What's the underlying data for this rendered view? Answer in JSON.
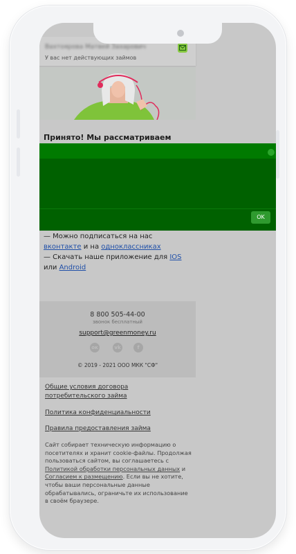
{
  "user": {
    "name": "Вахтоярова Матвей Захарович",
    "status": "У вас нет действующих займов"
  },
  "main": {
    "title": "Принято! Мы рассматриваем заявку"
  },
  "banner": {
    "ok_label": "OK"
  },
  "social_text": {
    "p1_prefix": "— Можно подписаться на нас ",
    "link_vk": "вконтакте",
    "p1_middle": " и на ",
    "link_ok": "одноклассниках",
    "p2_prefix": "— Скачать наше приложение для ",
    "link_ios": "IOS",
    "p2_middle": " или ",
    "link_android": "Android"
  },
  "footer": {
    "phone": "8 800 505-44-00",
    "phone_note": "звонок бесплатный",
    "email": "support@greenmoney.ru",
    "copyright": "© 2019 - 2021 ООО МКК \"СФ\""
  },
  "links": {
    "terms": "Общие условия договора потребительского займа",
    "privacy": "Политика конфиденциальности",
    "rules": "Правила предоставления займа"
  },
  "cookie_notice": {
    "part1": "Сайт собирает техническую информацию о посетителях и хранит cookie-файлы. Продолжая пользоваться сайтом, вы соглашаетесь с ",
    "link_policy": "Политикой обработки персональных данных",
    "part2": " и ",
    "link_consent": "Согласием к размещению",
    "part3": ". Если вы не хотите, чтобы ваши персональные данные обрабатывались, ограничьте их использование в своём браузере."
  },
  "colors": {
    "accent": "#006100",
    "banner_band": "#007a00",
    "ok_button": "#2f9a2f",
    "link": "#1f4fa8"
  }
}
